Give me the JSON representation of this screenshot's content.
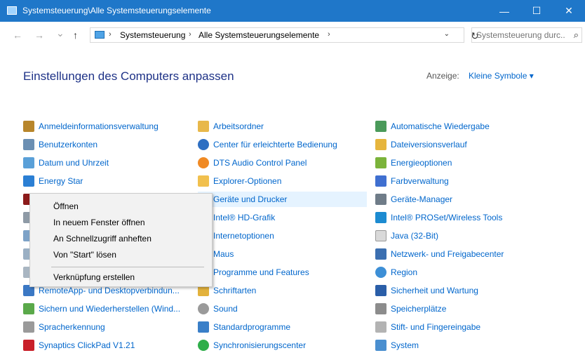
{
  "window": {
    "title": "Systemsteuerung\\Alle Systemsteuerungselemente",
    "minimize": "—",
    "maximize": "☐",
    "close": "✕"
  },
  "nav": {
    "back": "←",
    "forward": "→",
    "recent": "⌄",
    "up": "↑",
    "refresh": "↻"
  },
  "address": {
    "separator": "›",
    "crumbs": [
      "Systemsteuerung",
      "Alle Systemsteuerungselemente"
    ],
    "dropdown": "⌄"
  },
  "search": {
    "placeholder": "Systemsteuerung durc...",
    "icon": "⌕"
  },
  "heading": "Einstellungen des Computers anpassen",
  "view": {
    "label": "Anzeige:",
    "value": "Kleine Symbole ▾"
  },
  "items": {
    "col1": [
      "Anmeldeinformationsverwaltung",
      "Benutzerkonten",
      "Datum und Uhrzeit",
      "Energy Star",
      "RemoteApp- und Desktopverbindun...",
      "Sichern und Wiederherstellen (Wind...",
      "Spracherkennung",
      "Synaptics ClickPad V1.21"
    ],
    "col2": [
      "Arbeitsordner",
      "Center für erleichterte Bedienung",
      "DTS Audio Control Panel",
      "Explorer-Optionen",
      "Geräte und Drucker",
      "Intel® HD-Grafik",
      "Internetoptionen",
      "Maus",
      "Programme und Features",
      "Schriftarten",
      "Sound",
      "Standardprogramme",
      "Synchronisierungscenter"
    ],
    "col3": [
      "Automatische Wiedergabe",
      "Dateiversionsverlauf",
      "Energieoptionen",
      "Farbverwaltung",
      "Geräte-Manager",
      "Intel® PROSet/Wireless Tools",
      "Java (32-Bit)",
      "Netzwerk- und Freigabecenter",
      "Region",
      "Sicherheit und Wartung",
      "Speicherplätze",
      "Stift- und Fingereingabe",
      "System"
    ]
  },
  "context_menu": [
    "Öffnen",
    "In neuem Fenster öffnen",
    "An Schnellzugriff anheften",
    "Von \"Start\" lösen",
    "Verknüpfung erstellen"
  ],
  "colors": {
    "titlebar": "#1f77c9",
    "link": "#0066cc",
    "heading": "#1e3287",
    "hover": "#e5f3ff"
  }
}
